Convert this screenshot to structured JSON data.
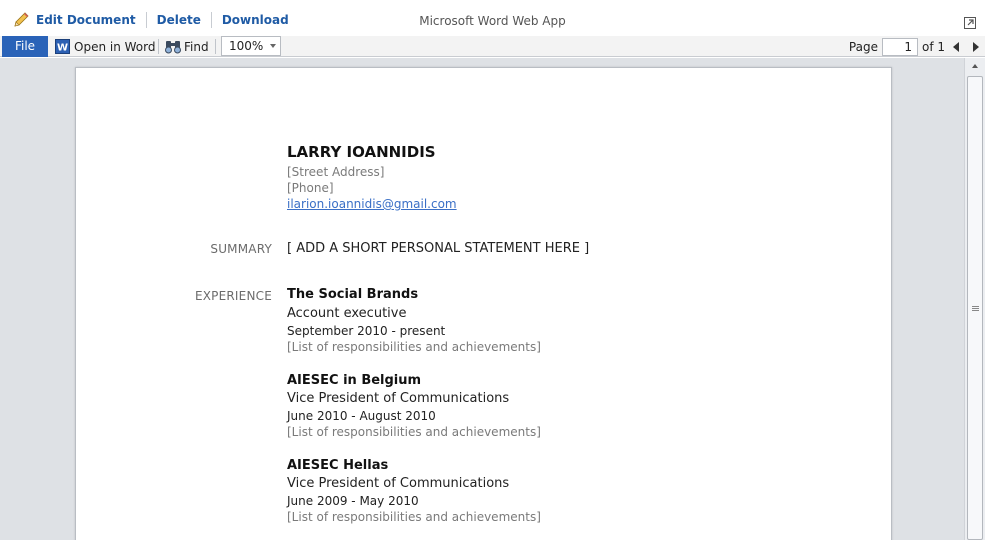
{
  "top_actions": {
    "edit": "Edit Document",
    "delete": "Delete",
    "download": "Download"
  },
  "app_title": "Microsoft Word Web App",
  "toolbar": {
    "file": "File",
    "open_in_word": "Open in Word",
    "find": "Find",
    "zoom": "100%",
    "page_label": "Page",
    "page_current": "1",
    "page_of": "of 1"
  },
  "document": {
    "name": "LARRY IOANNIDIS",
    "street": "[Street Address]",
    "phone": "[Phone]",
    "email": "ilarion.ioannidis@gmail.com",
    "summary_label": "SUMMARY",
    "summary_text": "[ ADD A SHORT PERSONAL STATEMENT HERE ]",
    "experience_label": "EXPERIENCE",
    "experience": [
      {
        "company": "The Social Brands",
        "role": "Account executive",
        "dates": "September 2010 - present",
        "details": "[List of responsibilities and achievements]"
      },
      {
        "company": "AIESEC in Belgium",
        "role": "Vice President of Communications",
        "dates": "June 2010 - August 2010",
        "details": "[List of responsibilities and achievements]"
      },
      {
        "company": "AIESEC Hellas",
        "role": "Vice President of Communications",
        "dates": "June 2009 - May 2010",
        "details": "[List of responsibilities and achievements]"
      }
    ]
  },
  "colors": {
    "accent": "#2a63b8",
    "link": "#3a6fc6",
    "viewer_bg": "#dee1e5"
  },
  "icons": [
    "pencil-icon",
    "popout-icon",
    "word-icon",
    "find-icon",
    "prev-page-icon",
    "next-page-icon",
    "scroll-up-icon"
  ]
}
